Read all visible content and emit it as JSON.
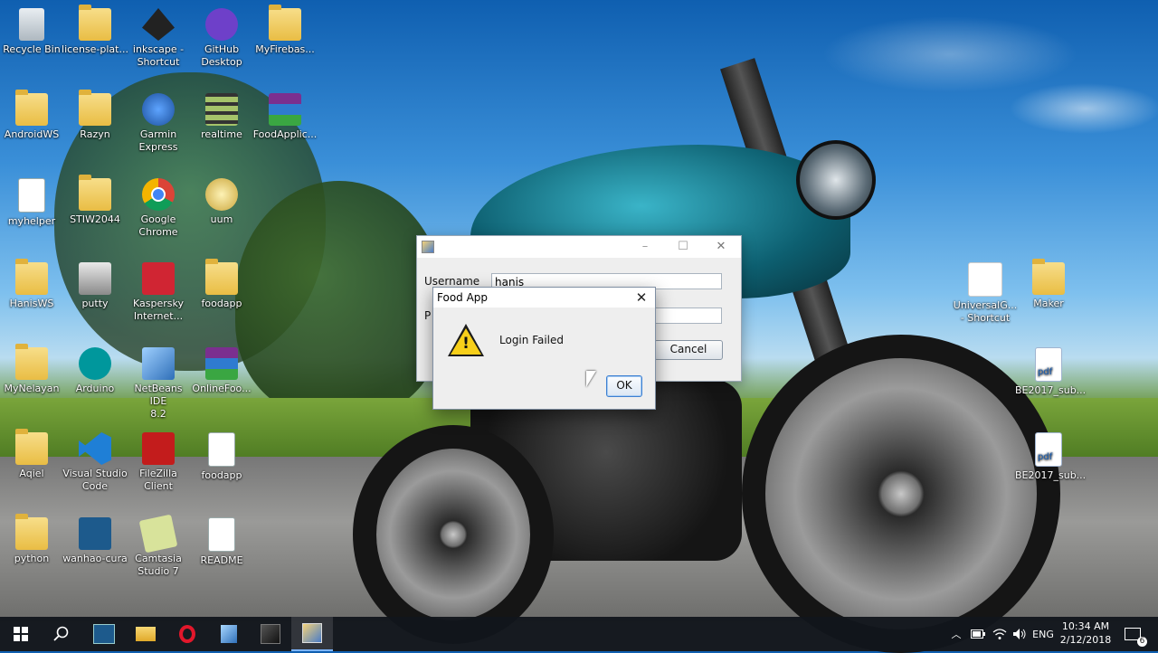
{
  "desktop": {
    "icons": [
      {
        "label": "Recycle Bin",
        "icon": "recycle-bin-icon"
      },
      {
        "label": "license-plat...",
        "icon": "folder-icon"
      },
      {
        "label": "inkscape -\nShortcut",
        "icon": "inkscape-icon"
      },
      {
        "label": "GitHub\nDesktop",
        "icon": "github-icon"
      },
      {
        "label": "MyFirebas...",
        "icon": "folder-icon"
      },
      {
        "label": "AndroidWS",
        "icon": "folder-icon"
      },
      {
        "label": "Razyn",
        "icon": "folder-icon"
      },
      {
        "label": "Garmin\nExpress",
        "icon": "garmin-icon"
      },
      {
        "label": "realtime",
        "icon": "video-icon"
      },
      {
        "label": "FoodApplic...",
        "icon": "winrar-icon"
      },
      {
        "label": "myhelper",
        "icon": "document-icon"
      },
      {
        "label": "STIW2044",
        "icon": "folder-icon"
      },
      {
        "label": "Google\nChrome",
        "icon": "chrome-icon"
      },
      {
        "label": "uum",
        "icon": "uum-logo-icon"
      },
      {
        "label": "HanisWS",
        "icon": "folder-icon"
      },
      {
        "label": "putty",
        "icon": "putty-icon"
      },
      {
        "label": "Kaspersky\nInternet...",
        "icon": "kaspersky-icon"
      },
      {
        "label": "foodapp",
        "icon": "folder-icon"
      },
      {
        "label": "MyNelayan",
        "icon": "folder-icon"
      },
      {
        "label": "Arduino",
        "icon": "arduino-icon"
      },
      {
        "label": "NetBeans IDE\n8.2",
        "icon": "netbeans-icon"
      },
      {
        "label": "OnlineFoo...",
        "icon": "winrar-icon"
      },
      {
        "label": "Aqiel",
        "icon": "folder-icon"
      },
      {
        "label": "Visual Studio\nCode",
        "icon": "vscode-icon"
      },
      {
        "label": "FileZilla\nClient",
        "icon": "filezilla-icon"
      },
      {
        "label": "foodapp",
        "icon": "document-icon"
      },
      {
        "label": "python",
        "icon": "folder-icon"
      },
      {
        "label": "wanhao-cura",
        "icon": "wanhao-icon"
      },
      {
        "label": "Camtasia\nStudio 7",
        "icon": "camtasia-icon"
      },
      {
        "label": "README",
        "icon": "text-file-icon"
      },
      {
        "label": "UniversalG...\n- Shortcut",
        "icon": "java-icon"
      },
      {
        "label": "Maker",
        "icon": "folder-icon"
      },
      {
        "label": "BE2017_sub...",
        "icon": "pdf-icon"
      },
      {
        "label": "BE2017_sub...",
        "icon": "pdf-icon"
      }
    ]
  },
  "login_window": {
    "username_label": "Username",
    "username_value": "hanis",
    "password_label_partial": "P",
    "cancel_label": "Cancel"
  },
  "dialog": {
    "title": "Food App",
    "message": "Login Failed",
    "ok_label": "OK",
    "icon": "warning-icon"
  },
  "taskbar": {
    "items": [
      "windows-start-icon",
      "search-icon",
      "wanhao-icon",
      "file-explorer-icon",
      "opera-icon",
      "netbeans-icon",
      "java-app-icon",
      "java-app-active-icon"
    ],
    "language": "ENG",
    "time": "10:34 AM",
    "date": "2/12/2018",
    "notifications_count": "6"
  }
}
